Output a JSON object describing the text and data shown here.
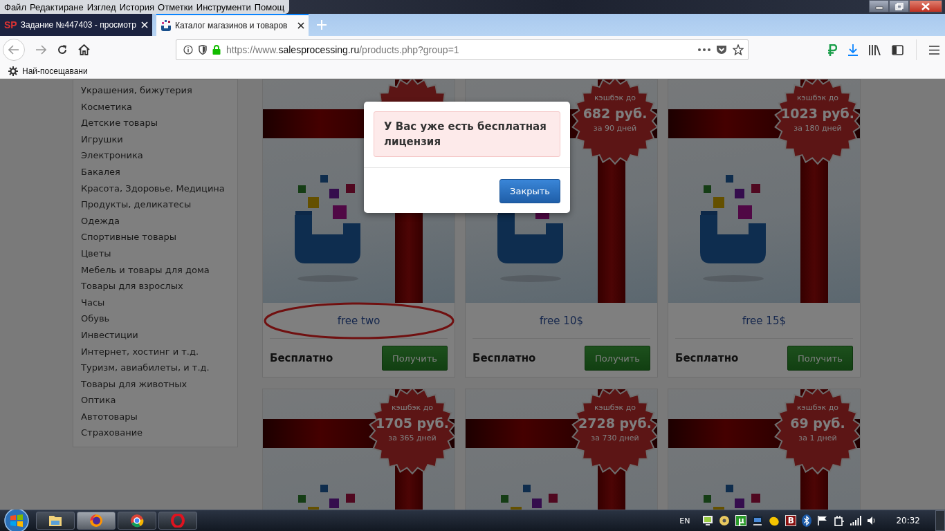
{
  "menu_bar": [
    "Файл",
    "Редактиране",
    "Изглед",
    "История",
    "Отметки",
    "Инструменти",
    "Помощ"
  ],
  "tabs": [
    {
      "title": "Задание №447403 - просмотр",
      "favicon": "SP",
      "selected": false
    },
    {
      "title": "Каталог магазинов и товаров",
      "selected": true
    }
  ],
  "address_bar": {
    "scheme": "https://www.",
    "domain": "salesprocessing.ru",
    "path": "/products.php?group=1"
  },
  "bookmarks": [
    "Най-посещавани"
  ],
  "sidebar": {
    "items": [
      "Украшения, бижутерия",
      "Косметика",
      "Детские товары",
      "Игрушки",
      "Электроника",
      "Бакалея",
      "Красота, Здоровье, Медицина",
      "Продукты, деликатесы",
      "Одежда",
      "Спортивные товары",
      "Цветы",
      "Мебель и товары для дома",
      "Товары для взрослых",
      "Часы",
      "Обувь",
      "Инвестиции",
      "Интернет, хостинг и т.д.",
      "Туризм, авиабилеты, и т.д.",
      "Товары для животных",
      "Оптика",
      "Автотовары",
      "Страхование"
    ]
  },
  "products": [
    {
      "title": "free two",
      "price": "Бесплатно",
      "button": "Получить",
      "circled": true
    },
    {
      "title": "free 10$",
      "price": "Бесплатно",
      "button": "Получить",
      "circled": false,
      "badge": {
        "caption": "кэшбэк до",
        "amount": "682 руб.",
        "period": "за 90 дней"
      }
    },
    {
      "title": "free 15$",
      "price": "Бесплатно",
      "button": "Получить",
      "circled": false,
      "badge": {
        "caption": "кэшбэк до",
        "amount": "1023 руб.",
        "period": "за 180 дней"
      }
    },
    {
      "badge": {
        "caption": "кэшбэк до",
        "amount": "1705 руб.",
        "period": "за 365 дней"
      }
    },
    {
      "badge": {
        "caption": "кэшбэк до",
        "amount": "2728 руб.",
        "period": "за 730 дней"
      }
    },
    {
      "badge": {
        "caption": "кэшбэк до",
        "amount": "69 руб.",
        "period": "за 1 дней"
      }
    }
  ],
  "modal": {
    "message": "У Вас уже есть бесплатная лицензия",
    "button": "Закрыть"
  },
  "taskbar": {
    "apps": [
      {
        "kind": "explorer",
        "selected": false
      },
      {
        "kind": "firefox",
        "selected": true
      },
      {
        "kind": "chrome",
        "selected": false
      },
      {
        "kind": "opera",
        "selected": false
      }
    ],
    "language": "EN",
    "tray": [
      {
        "kind": "monitor"
      },
      {
        "kind": "disc"
      },
      {
        "kind": "torrent",
        "label": "µ"
      },
      {
        "kind": "network"
      },
      {
        "kind": "lemon"
      },
      {
        "kind": "letter",
        "label": "B"
      },
      {
        "kind": "bluetooth"
      },
      {
        "kind": "flag"
      },
      {
        "kind": "power"
      },
      {
        "kind": "signal"
      },
      {
        "kind": "volume"
      }
    ],
    "clock": "20:32"
  }
}
